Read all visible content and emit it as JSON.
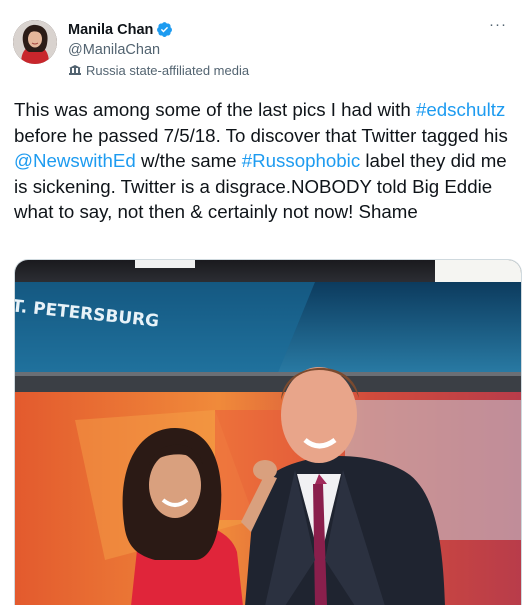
{
  "author": {
    "display_name": "Manila Chan",
    "handle": "@ManilaChan",
    "verified": true,
    "label": "Russia state-affiliated media"
  },
  "more_icon_text": "···",
  "tweet": {
    "segments": [
      {
        "text": "This was among some of the last pics I had with ",
        "type": "text"
      },
      {
        "text": "#edschultz",
        "type": "link"
      },
      {
        "text": " before he passed 7/5/18. To discover that Twitter tagged his ",
        "type": "text"
      },
      {
        "text": "@NewswithEd",
        "type": "link"
      },
      {
        "text": " w/the same ",
        "type": "text"
      },
      {
        "text": "#Russophobic",
        "type": "link"
      },
      {
        "text": " label they did me is sickening. Twitter is a disgrace.NOBODY told Big Eddie what to say, not then & certainly not now! Shame",
        "type": "text"
      }
    ]
  },
  "media": {
    "sign_text": "T. PETERSBURG"
  },
  "colors": {
    "link": "#1d9bf0",
    "verified": "#1d9bf0",
    "secondary_text": "#536471"
  }
}
